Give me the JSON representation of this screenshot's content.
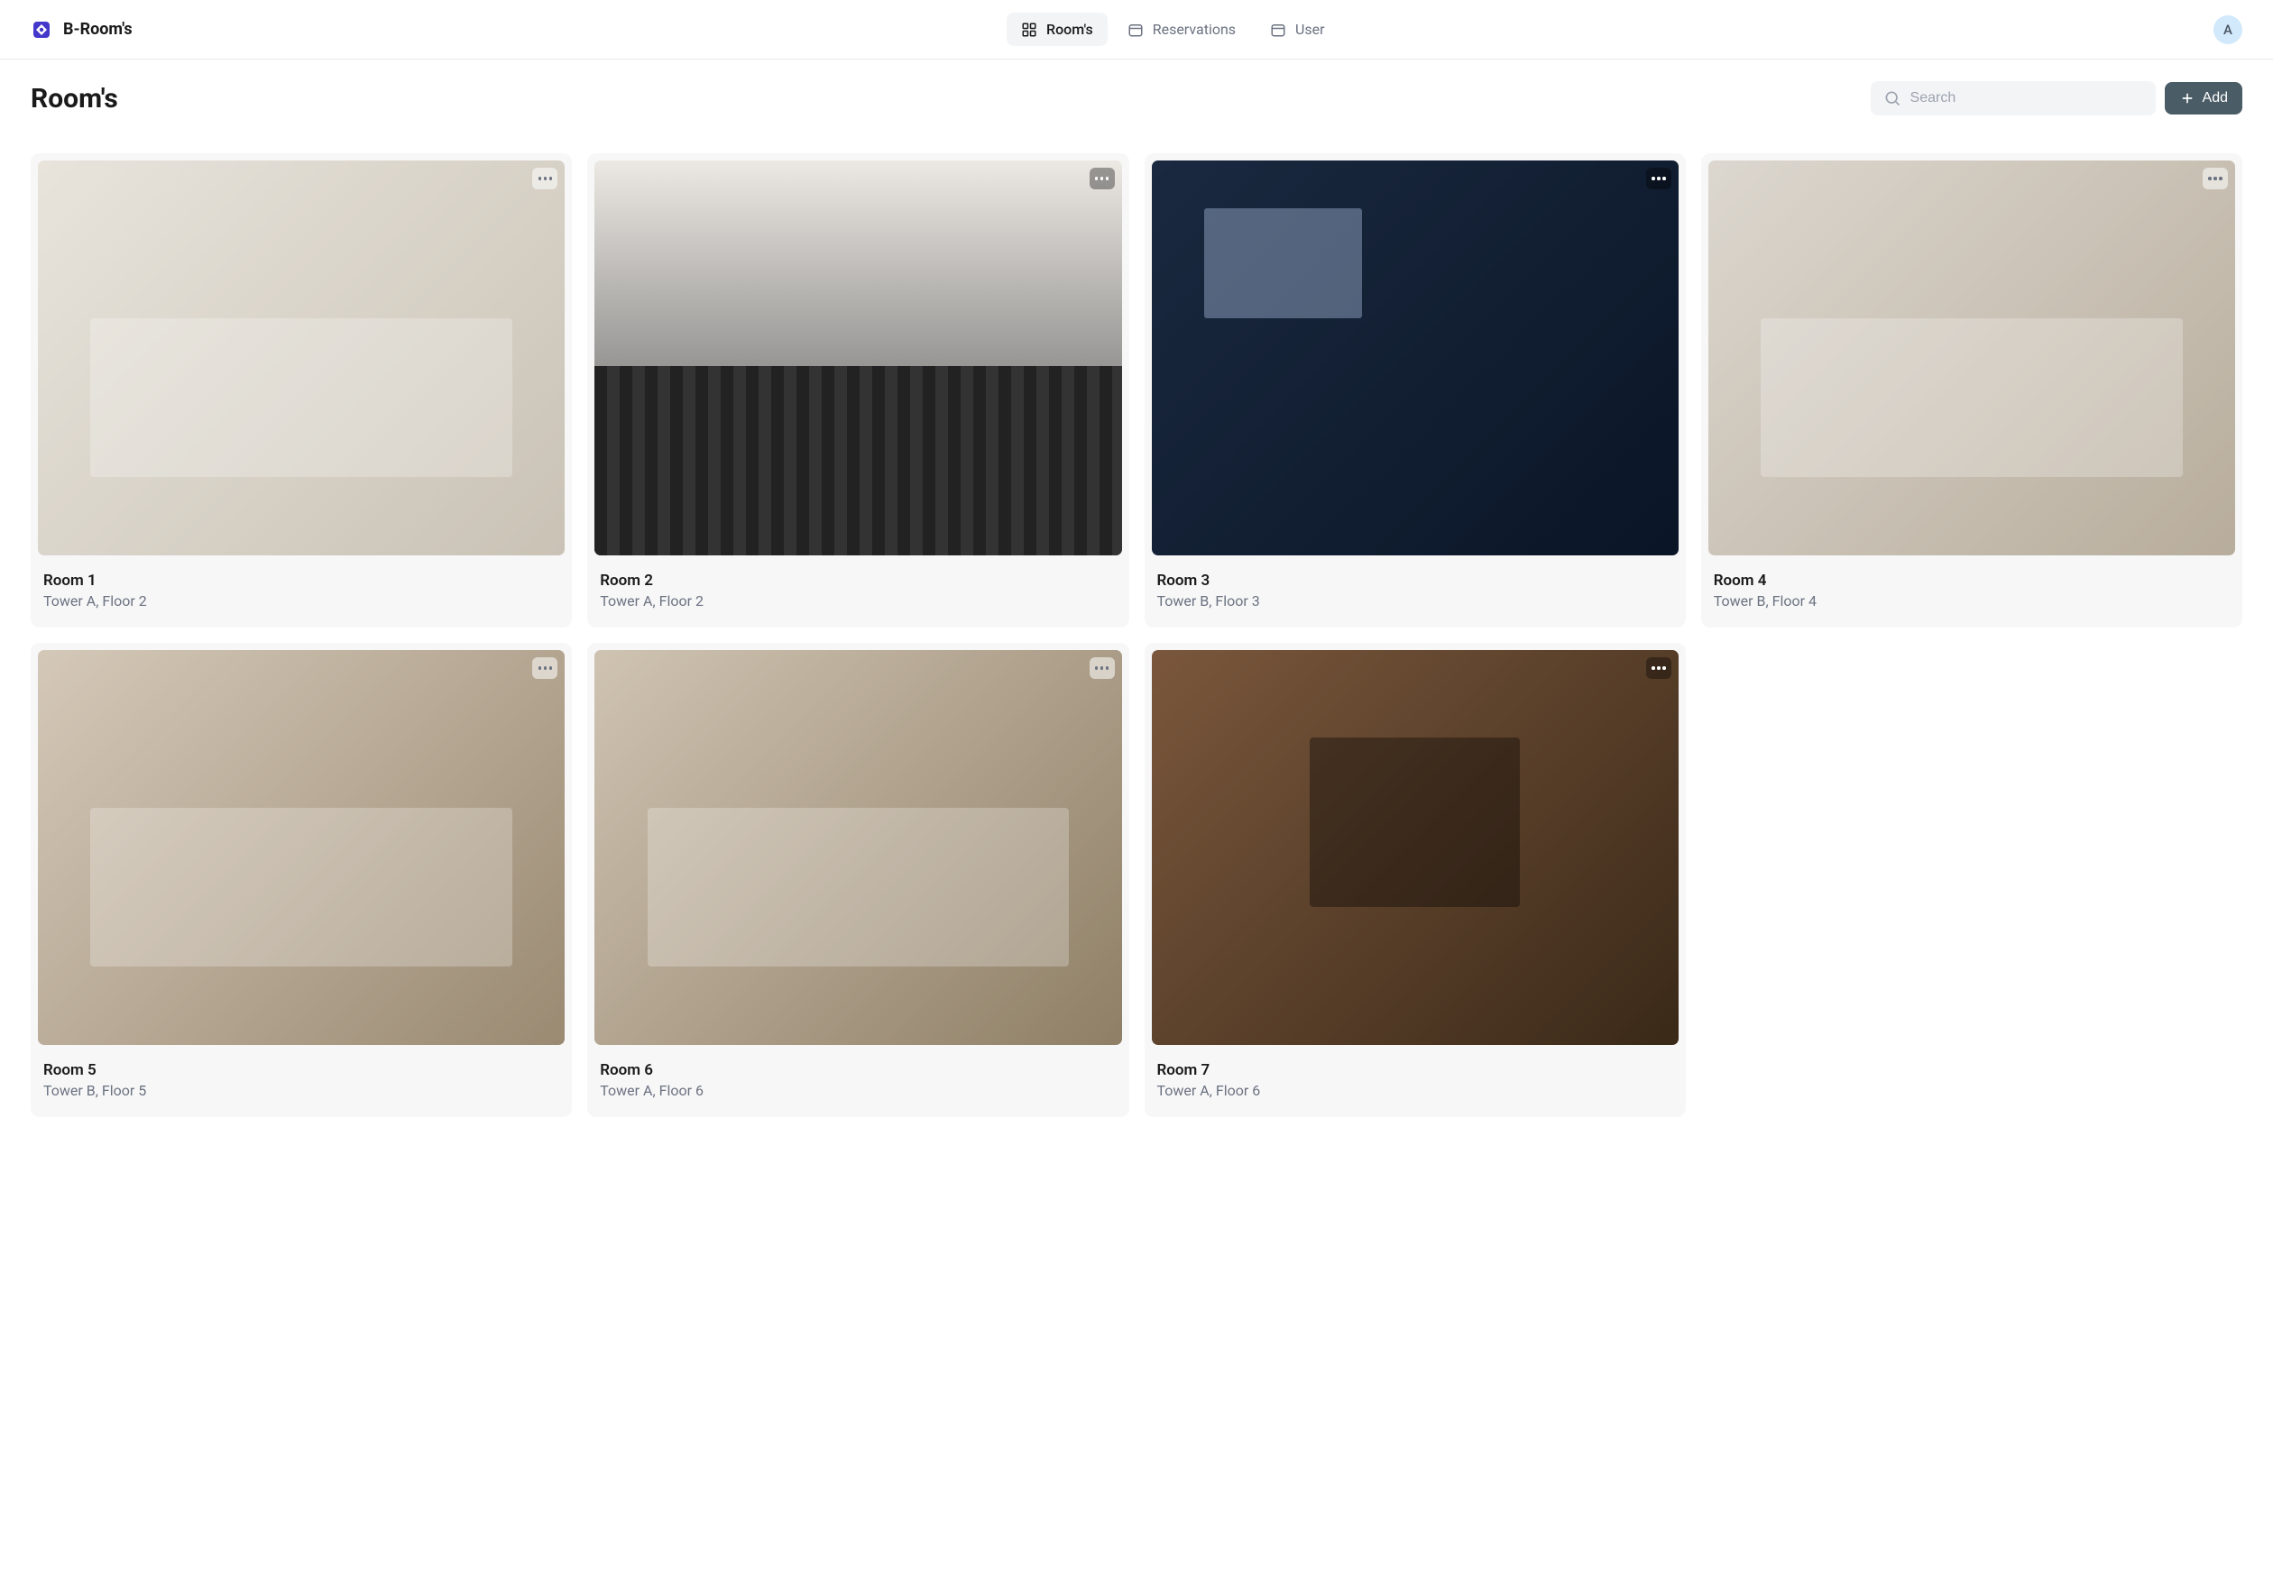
{
  "brand": "B-Room's",
  "nav": {
    "rooms": "Room's",
    "reservations": "Reservations",
    "user": "User"
  },
  "avatar_initial": "A",
  "page_title": "Room's",
  "search_placeholder": "Search",
  "add_label": "Add",
  "rooms": [
    {
      "title": "Room 1",
      "location": "Tower A, Floor 2",
      "img": "img-1",
      "menu_style": "light"
    },
    {
      "title": "Room 2",
      "location": "Tower A, Floor 2",
      "img": "img-2",
      "menu_style": "dark"
    },
    {
      "title": "Room 3",
      "location": "Tower B, Floor 3",
      "img": "img-3",
      "menu_style": "dark"
    },
    {
      "title": "Room 4",
      "location": "Tower B, Floor 4",
      "img": "img-4",
      "menu_style": "light"
    },
    {
      "title": "Room 5",
      "location": "Tower B, Floor 5",
      "img": "img-5",
      "menu_style": "light"
    },
    {
      "title": "Room 6",
      "location": "Tower A, Floor 6",
      "img": "img-6",
      "menu_style": "light"
    },
    {
      "title": "Room 7",
      "location": "Tower A, Floor 6",
      "img": "img-7",
      "menu_style": "dark"
    }
  ]
}
